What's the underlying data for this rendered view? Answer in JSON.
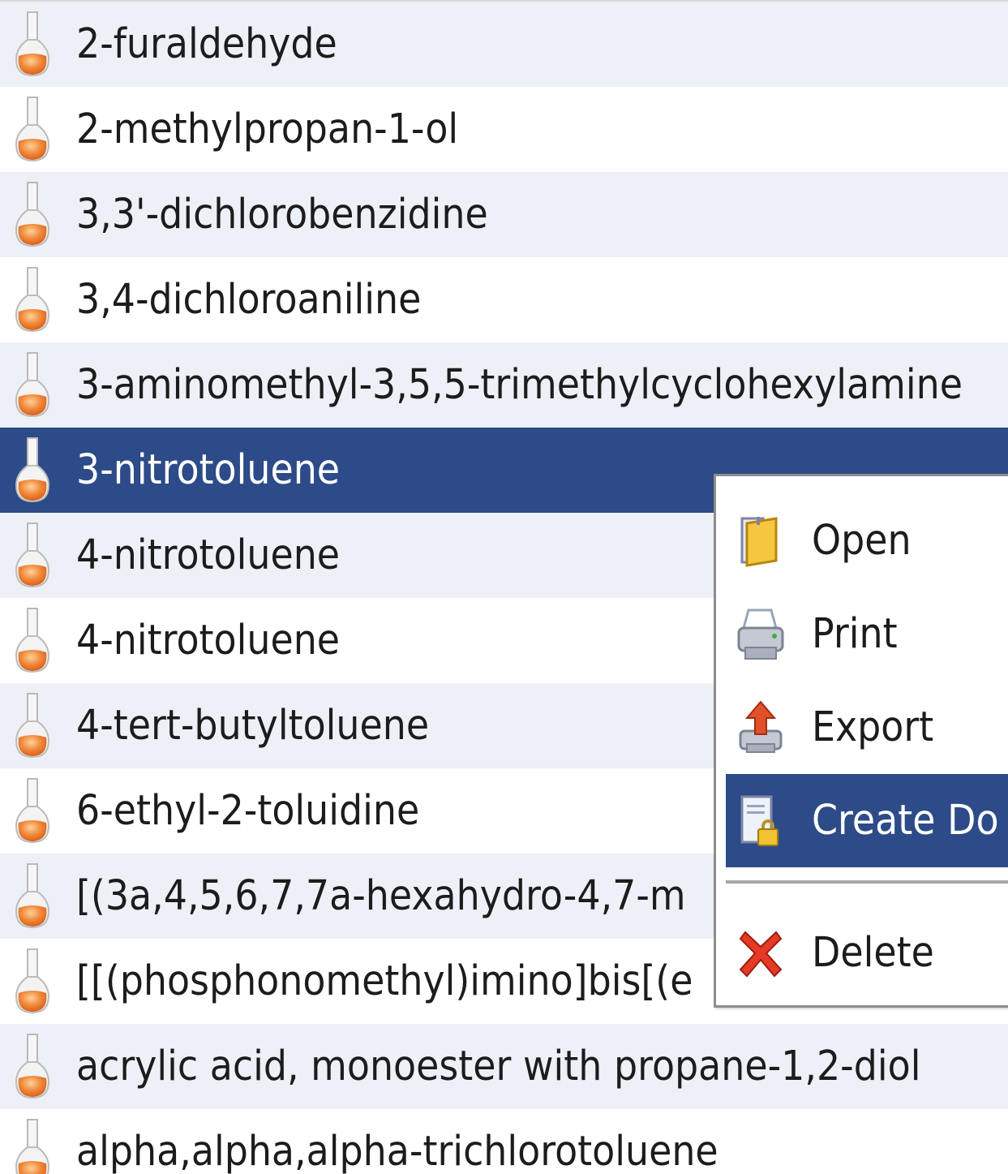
{
  "compound_list": {
    "items": [
      {
        "label": "2-furaldehyde"
      },
      {
        "label": "2-methylpropan-1-ol"
      },
      {
        "label": "3,3'-dichlorobenzidine"
      },
      {
        "label": "3,4-dichloroaniline"
      },
      {
        "label": "3-aminomethyl-3,5,5-trimethylcyclohexylamine"
      },
      {
        "label": "3-nitrotoluene"
      },
      {
        "label": "4-nitrotoluene"
      },
      {
        "label": "4-nitrotoluene"
      },
      {
        "label": "4-tert-butyltoluene"
      },
      {
        "label": "6-ethyl-2-toluidine"
      },
      {
        "label": "[(3a,4,5,6,7,7a-hexahydro-4,7-m"
      },
      {
        "label": "[[(phosphonomethyl)imino]bis[(e"
      },
      {
        "label": "acrylic acid, monoester with propane-1,2-diol"
      },
      {
        "label": "alpha,alpha,alpha-trichlorotoluene"
      }
    ],
    "selected_index": 5,
    "item_icon": "flask-icon"
  },
  "context_menu": {
    "items": [
      {
        "label": "Open",
        "icon": "folder-icon"
      },
      {
        "label": "Print",
        "icon": "printer-icon"
      },
      {
        "label": "Export",
        "icon": "export-icon"
      },
      {
        "label": "Create Do",
        "icon": "create-dossier-icon"
      },
      {
        "label": "Delete",
        "icon": "delete-icon"
      }
    ],
    "highlighted_index": 3
  },
  "colors": {
    "selection": "#2c4b88",
    "alt_row": "#edf0f6",
    "flask_liquid": "#f08a3c"
  }
}
